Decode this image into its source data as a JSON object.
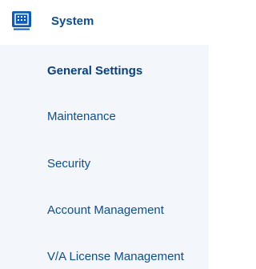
{
  "section": {
    "icon": "system-panel-icon",
    "title": "System"
  },
  "menu": {
    "active_index": 0,
    "items": [
      {
        "label": "General Settings"
      },
      {
        "label": "Maintenance"
      },
      {
        "label": "Security"
      },
      {
        "label": "Account Management"
      },
      {
        "label": "V/A License Management"
      }
    ]
  },
  "colors": {
    "accent": "#0b4d9c",
    "submenu_background": "#f3f7fc"
  }
}
